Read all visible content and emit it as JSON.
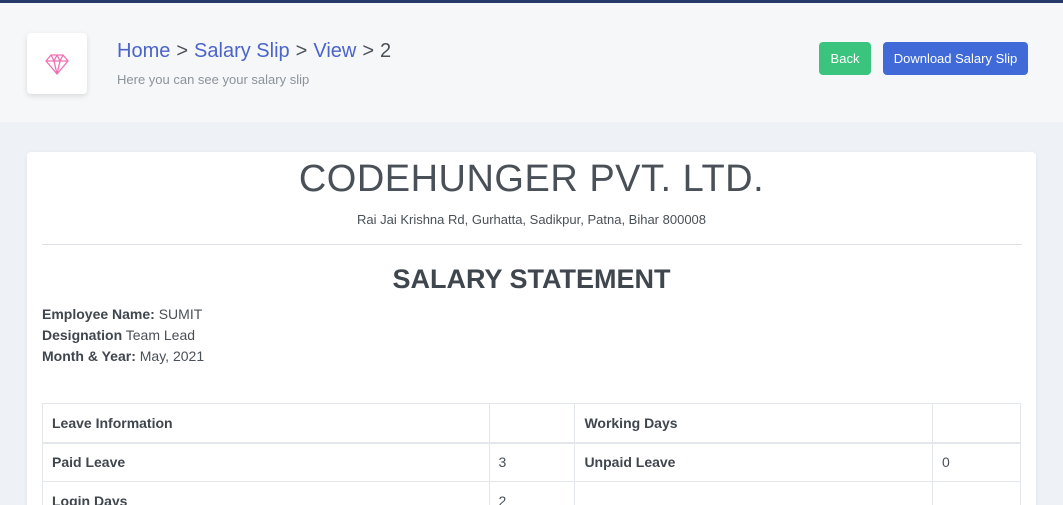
{
  "header": {
    "breadcrumb": {
      "home": "Home",
      "salary_slip": "Salary Slip",
      "view": "View",
      "id": "2",
      "separator": ">"
    },
    "subtitle": "Here you can see your salary slip",
    "back_label": "Back",
    "download_label": "Download Salary Slip",
    "icon": "diamond-icon"
  },
  "slip": {
    "company": "CODEHUNGER PVT. LTD.",
    "address": "Rai Jai Krishna Rd, Gurhatta, Sadikpur, Patna, Bihar 800008",
    "statement_title": "SALARY STATEMENT",
    "employee_label": "Employee Name:",
    "employee_value": "SUMIT",
    "designation_label": "Designation",
    "designation_value": "Team Lead",
    "month_label": "Month & Year:",
    "month_value": "May, 2021"
  },
  "table": {
    "leave_info": "Leave Information",
    "working_days": "Working Days",
    "paid_leave": "Paid Leave",
    "paid_leave_value": "3",
    "unpaid_leave": "Unpaid Leave",
    "unpaid_leave_value": "0",
    "login_days": "Login Days",
    "login_days_value": "2"
  },
  "colors": {
    "accent": "#3f6ad8",
    "success": "#3ac47d",
    "link": "#4a64c9",
    "icon": "#f06fb4"
  }
}
